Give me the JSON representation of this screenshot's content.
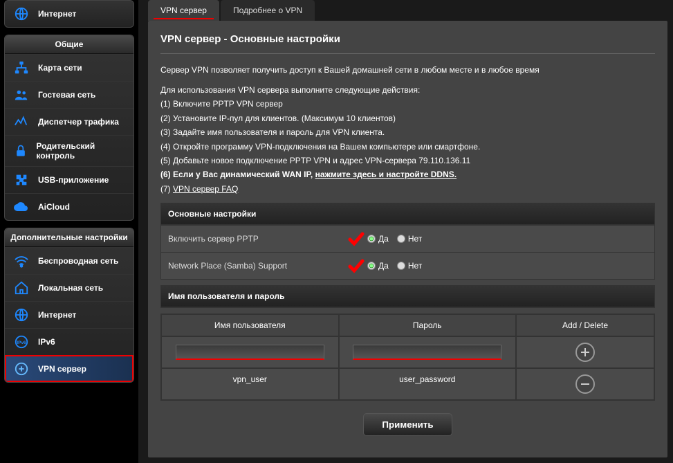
{
  "sidebar": {
    "top_item": "Интернет",
    "group1": {
      "header": "Общие",
      "items": [
        "Карта сети",
        "Гостевая сеть",
        "Диспетчер трафика",
        "Родительский контроль",
        "USB-приложение",
        "AiCloud"
      ]
    },
    "group2": {
      "header": "Дополнительные настройки",
      "items": [
        "Беспроводная сеть",
        "Локальная сеть",
        "Интернет",
        "IPv6",
        "VPN сервер"
      ]
    }
  },
  "tabs": {
    "active": "VPN сервер",
    "other": "Подробнее о VPN"
  },
  "page": {
    "title": "VPN сервер - Основные настройки",
    "intro": "Сервер VPN позволяет получить доступ к Вашей домашней сети в любом месте и в любое время",
    "preamble": "Для использования VPN сервера выполните следующие действия:",
    "steps": [
      "(1) Включите PPTP VPN сервер",
      "(2) Установите IP-пул для клиентов. (Максимум 10 клиентов)",
      "(3) Задайте имя пользователя и пароль для VPN клиента.",
      "(4) Откройте программу VPN-подключения на Вашем компьютере или смартфоне.",
      "(5) Добавьте новое подключение PPTP VPN и адрес VPN-сервера 79.110.136.11"
    ],
    "step6": "(6) Если у Вас динамический WAN IP, ",
    "step6_link": "нажмите здесь и настройте DDNS.",
    "faq": "(7) ",
    "faq_link": "VPN сервер FAQ",
    "section_basic": "Основные настройки",
    "enable_pptp": "Включить сервер PPTP",
    "samba": "Network Place (Samba) Support",
    "yes": "Да",
    "no": "Нет",
    "section_user": "Имя пользователя и пароль",
    "col_user": "Имя пользователя",
    "col_pass": "Пароль",
    "col_act": "Add / Delete",
    "row_user": "vpn_user",
    "row_pass": "user_password",
    "apply": "Применить"
  }
}
